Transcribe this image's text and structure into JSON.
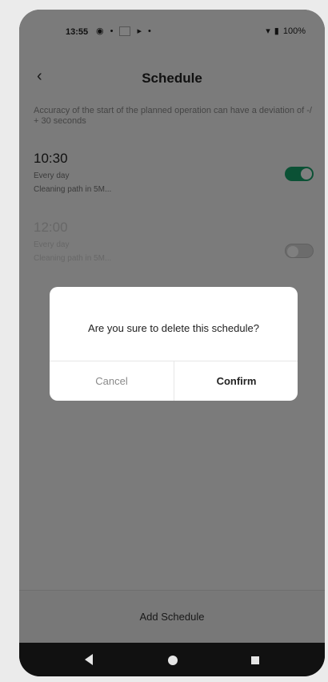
{
  "status_bar": {
    "time": "13:55",
    "left_icons": [
      "notification-icon",
      "dot-icon",
      "square-icon",
      "media-icon",
      "dot-icon"
    ],
    "battery": "100%"
  },
  "header": {
    "title": "Schedule",
    "back_icon": "‹"
  },
  "notice": "Accuracy of the start of the planned operation can have a deviation of -/ + 30 seconds",
  "schedules": [
    {
      "time": "10:30",
      "repeat": "Every day",
      "mode": "Cleaning path in 5M...",
      "enabled": true
    },
    {
      "time": "12:00",
      "repeat": "Every day",
      "mode": "Cleaning path in 5M...",
      "enabled": false
    }
  ],
  "add_button": "Add Schedule",
  "dialog": {
    "message": "Are you sure to delete this schedule?",
    "cancel": "Cancel",
    "confirm": "Confirm"
  },
  "colors": {
    "toggle_on": "#16a36a",
    "toggle_off": "#d8d8d8",
    "scrim": "#000000"
  }
}
